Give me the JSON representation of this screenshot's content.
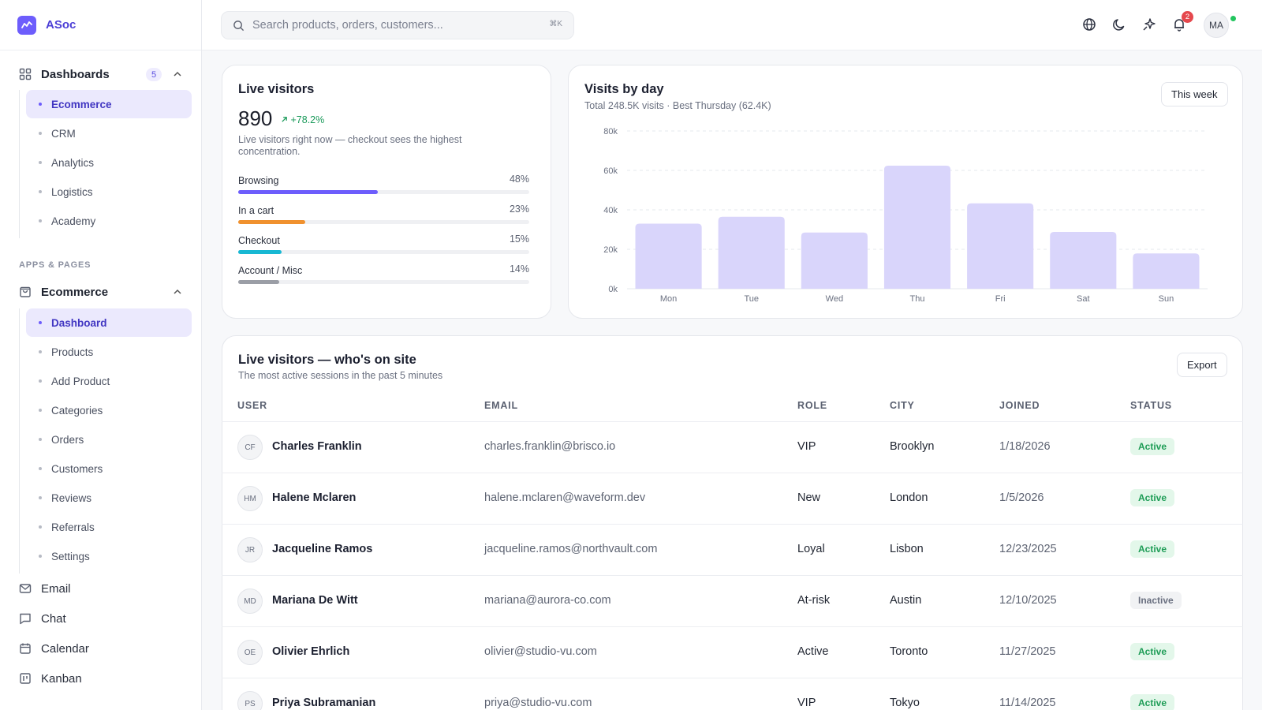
{
  "app": {
    "name": "ASoc"
  },
  "sidebar": {
    "dashboards": {
      "label": "Dashboards",
      "count": "5",
      "items": [
        "Ecommerce",
        "CRM",
        "Analytics",
        "Logistics",
        "Academy"
      ]
    },
    "section_title": "APPS & PAGES",
    "ecommerce": {
      "label": "Ecommerce",
      "items": [
        "Dashboard",
        "Products",
        "Add Product",
        "Categories",
        "Orders",
        "Customers",
        "Reviews",
        "Referrals",
        "Settings"
      ]
    },
    "apps": [
      "Email",
      "Chat",
      "Calendar",
      "Kanban"
    ]
  },
  "topbar": {
    "search_placeholder": "Search products, orders, customers...",
    "shortcut": "⌘K",
    "notification_count": "2",
    "avatar_initials": "MA"
  },
  "live_visitors": {
    "title": "Live visitors",
    "value": "890",
    "change": "+78.2%",
    "description": "Live visitors right now — checkout sees the highest concentration.",
    "metrics": [
      {
        "label": "Browsing",
        "pct_text": "48%",
        "fraction": 0.48,
        "color": "#6d5dfc"
      },
      {
        "label": "In a cart",
        "pct_text": "23%",
        "fraction": 0.23,
        "color": "#f0912e"
      },
      {
        "label": "Checkout",
        "pct_text": "15%",
        "fraction": 0.15,
        "color": "#17b8d3"
      },
      {
        "label": "Account / Misc",
        "pct_text": "14%",
        "fraction": 0.14,
        "color": "#9b9ea6"
      }
    ]
  },
  "visits_card": {
    "title": "Visits by day",
    "subtitle": "Total 248.5K visits · Best Thursday (62.4K)",
    "range_button": "This week"
  },
  "chart_data": {
    "type": "bar",
    "categories": [
      "Mon",
      "Tue",
      "Wed",
      "Thu",
      "Fri",
      "Sat",
      "Sun"
    ],
    "values": [
      33000,
      36500,
      28500,
      62400,
      43300,
      28800,
      17900
    ],
    "y_ticks": [
      "0k",
      "20k",
      "40k",
      "60k",
      "80k"
    ],
    "ylim": [
      0,
      80000
    ],
    "grid": true,
    "bar_color": "#d9d5fb"
  },
  "sessions": {
    "title": "Live visitors — who's on site",
    "subtitle": "The most active sessions in the past 5 minutes",
    "export_label": "Export",
    "columns": [
      "USER",
      "EMAIL",
      "ROLE",
      "CITY",
      "JOINED",
      "STATUS"
    ],
    "rows": [
      {
        "initials": "CF",
        "name": "Charles Franklin",
        "email": "charles.franklin@brisco.io",
        "role": "VIP",
        "city": "Brooklyn",
        "joined": "1/18/2026",
        "status": "Active"
      },
      {
        "initials": "HM",
        "name": "Halene Mclaren",
        "email": "halene.mclaren@waveform.dev",
        "role": "New",
        "city": "London",
        "joined": "1/5/2026",
        "status": "Active"
      },
      {
        "initials": "JR",
        "name": "Jacqueline Ramos",
        "email": "jacqueline.ramos@northvault.com",
        "role": "Loyal",
        "city": "Lisbon",
        "joined": "12/23/2025",
        "status": "Active"
      },
      {
        "initials": "MD",
        "name": "Mariana De Witt",
        "email": "mariana@aurora-co.com",
        "role": "At-risk",
        "city": "Austin",
        "joined": "12/10/2025",
        "status": "Inactive"
      },
      {
        "initials": "OE",
        "name": "Olivier Ehrlich",
        "email": "olivier@studio-vu.com",
        "role": "Active",
        "city": "Toronto",
        "joined": "11/27/2025",
        "status": "Active"
      },
      {
        "initials": "PS",
        "name": "Priya Subramanian",
        "email": "priya@studio-vu.com",
        "role": "VIP",
        "city": "Tokyo",
        "joined": "11/14/2025",
        "status": "Active"
      }
    ]
  }
}
